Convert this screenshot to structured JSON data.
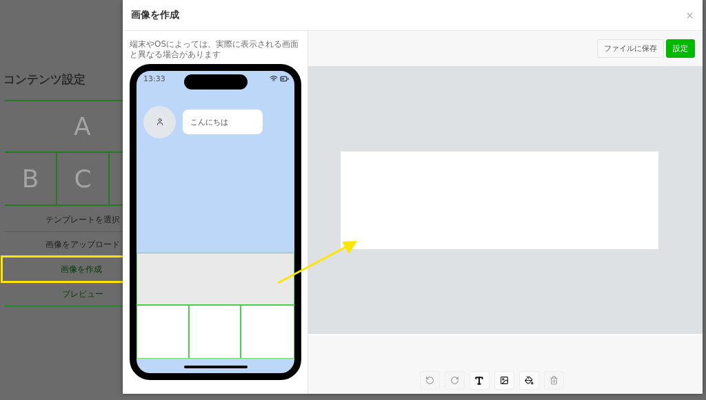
{
  "background_page": {
    "heading": "コンテンツ設定",
    "layout_cells": [
      "A",
      "B",
      "C"
    ],
    "menu": [
      {
        "label": "テンプレートを選択",
        "kind": "option",
        "selected": false
      },
      {
        "label": "画像をアップロード",
        "kind": "option",
        "selected": false
      },
      {
        "label": "画像を作成",
        "kind": "option",
        "selected": true
      },
      {
        "label": "プレビュー",
        "kind": "link",
        "selected": false
      }
    ]
  },
  "dialog": {
    "title": "画像を作成",
    "note": "端末やOSによっては、実際に表示される画面と異なる場合があります",
    "phone": {
      "time": "13:33",
      "message": "こんにちは"
    },
    "buttons": [
      {
        "label": "ファイルに保存",
        "kind": "secondary"
      },
      {
        "label": "設定",
        "kind": "primary"
      }
    ],
    "tools": [
      {
        "kind": "undo",
        "disabled": true
      },
      {
        "kind": "redo",
        "disabled": true
      },
      {
        "kind": "text",
        "disabled": false
      },
      {
        "kind": "image",
        "disabled": false
      },
      {
        "kind": "fill",
        "disabled": false
      },
      {
        "kind": "delete",
        "disabled": true
      }
    ]
  }
}
